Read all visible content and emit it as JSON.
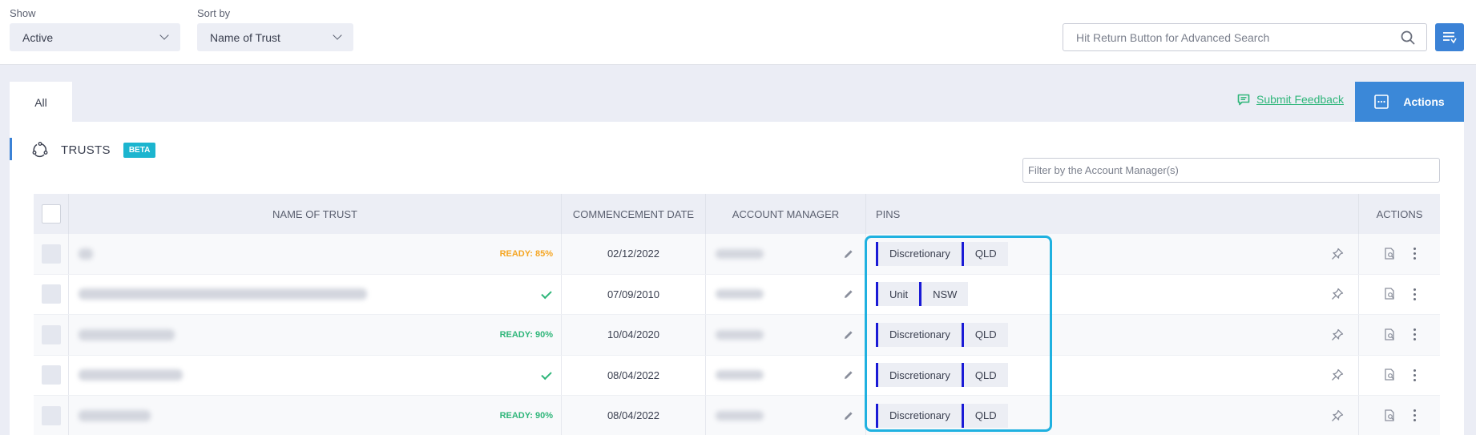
{
  "filters": {
    "show_label": "Show",
    "show_value": "Active",
    "sort_label": "Sort by",
    "sort_value": "Name of Trust",
    "search_placeholder": "Hit Return Button for Advanced Search"
  },
  "tabs": {
    "all": "All"
  },
  "header_actions": {
    "feedback": "Submit Feedback",
    "actions": "Actions"
  },
  "section": {
    "title": "TRUSTS",
    "badge": "BETA",
    "am_filter_placeholder": "Filter by the Account Manager(s)"
  },
  "table": {
    "columns": [
      "NAME OF TRUST",
      "COMMENCEMENT DATE",
      "ACCOUNT MANAGER",
      "PINS",
      "ACTIONS"
    ],
    "rows": [
      {
        "status": "READY: 85%",
        "status_color": "orange",
        "date": "02/12/2022",
        "pins": [
          "Discretionary",
          "QLD"
        ]
      },
      {
        "status": "",
        "done": true,
        "date": "07/09/2010",
        "pins": [
          "Unit",
          "NSW"
        ]
      },
      {
        "status": "READY: 90%",
        "status_color": "green",
        "date": "10/04/2020",
        "pins": [
          "Discretionary",
          "QLD"
        ]
      },
      {
        "status": "",
        "done": true,
        "date": "08/04/2022",
        "pins": [
          "Discretionary",
          "QLD"
        ]
      },
      {
        "status": "READY: 90%",
        "status_color": "green",
        "date": "08/04/2022",
        "pins": [
          "Discretionary",
          "QLD"
        ]
      }
    ]
  },
  "colors": {
    "accent": "#3b88d8",
    "pin_bar": "#1a1ad6",
    "highlight": "#1fb1e0",
    "ready_orange": "#f5a623",
    "ready_green": "#2fb67a"
  }
}
